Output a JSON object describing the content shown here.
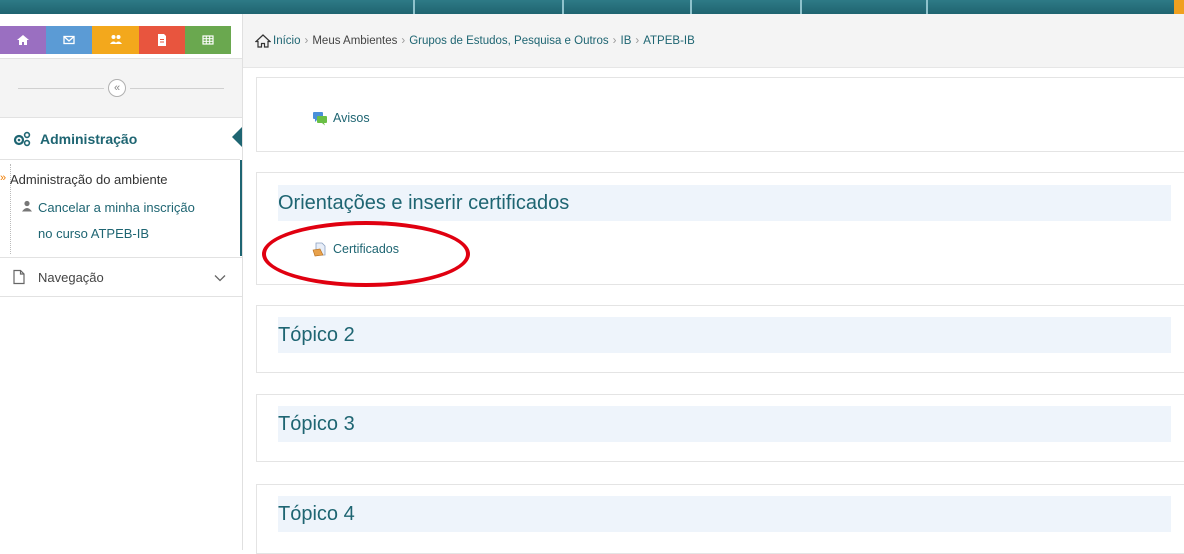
{
  "quicklinks": [
    {
      "name": "home-icon",
      "color": "#9a6fc1"
    },
    {
      "name": "mail-icon",
      "color": "#5b9bd5"
    },
    {
      "name": "users-icon",
      "color": "#f3a81c"
    },
    {
      "name": "document-icon",
      "color": "#e8553e"
    },
    {
      "name": "grid-icon",
      "color": "#6aa84f"
    }
  ],
  "sidebar": {
    "collapse_symbol": "«",
    "admin_title": "Administração",
    "admin_items": {
      "ambiente": "Administração do ambiente",
      "cancel_line1": "Cancelar a minha inscrição",
      "cancel_line2": "no curso ATPEB-IB"
    },
    "nav_label": "Navegação"
  },
  "breadcrumb": {
    "home": "Início",
    "items": [
      "Meus Ambientes",
      "Grupos de Estudos, Pesquisa e Outros",
      "IB",
      "ATPEB-IB"
    ]
  },
  "sections": {
    "avisos": "Avisos",
    "orientacoes_title": "Orientações e inserir certificados",
    "certificados": "Certificados",
    "topico2": "Tópico 2",
    "topico3": "Tópico 3",
    "topico4": "Tópico 4"
  },
  "colors": {
    "accent": "#1e6572",
    "highlight": "#e00010",
    "section_bg": "#eef4fb"
  }
}
